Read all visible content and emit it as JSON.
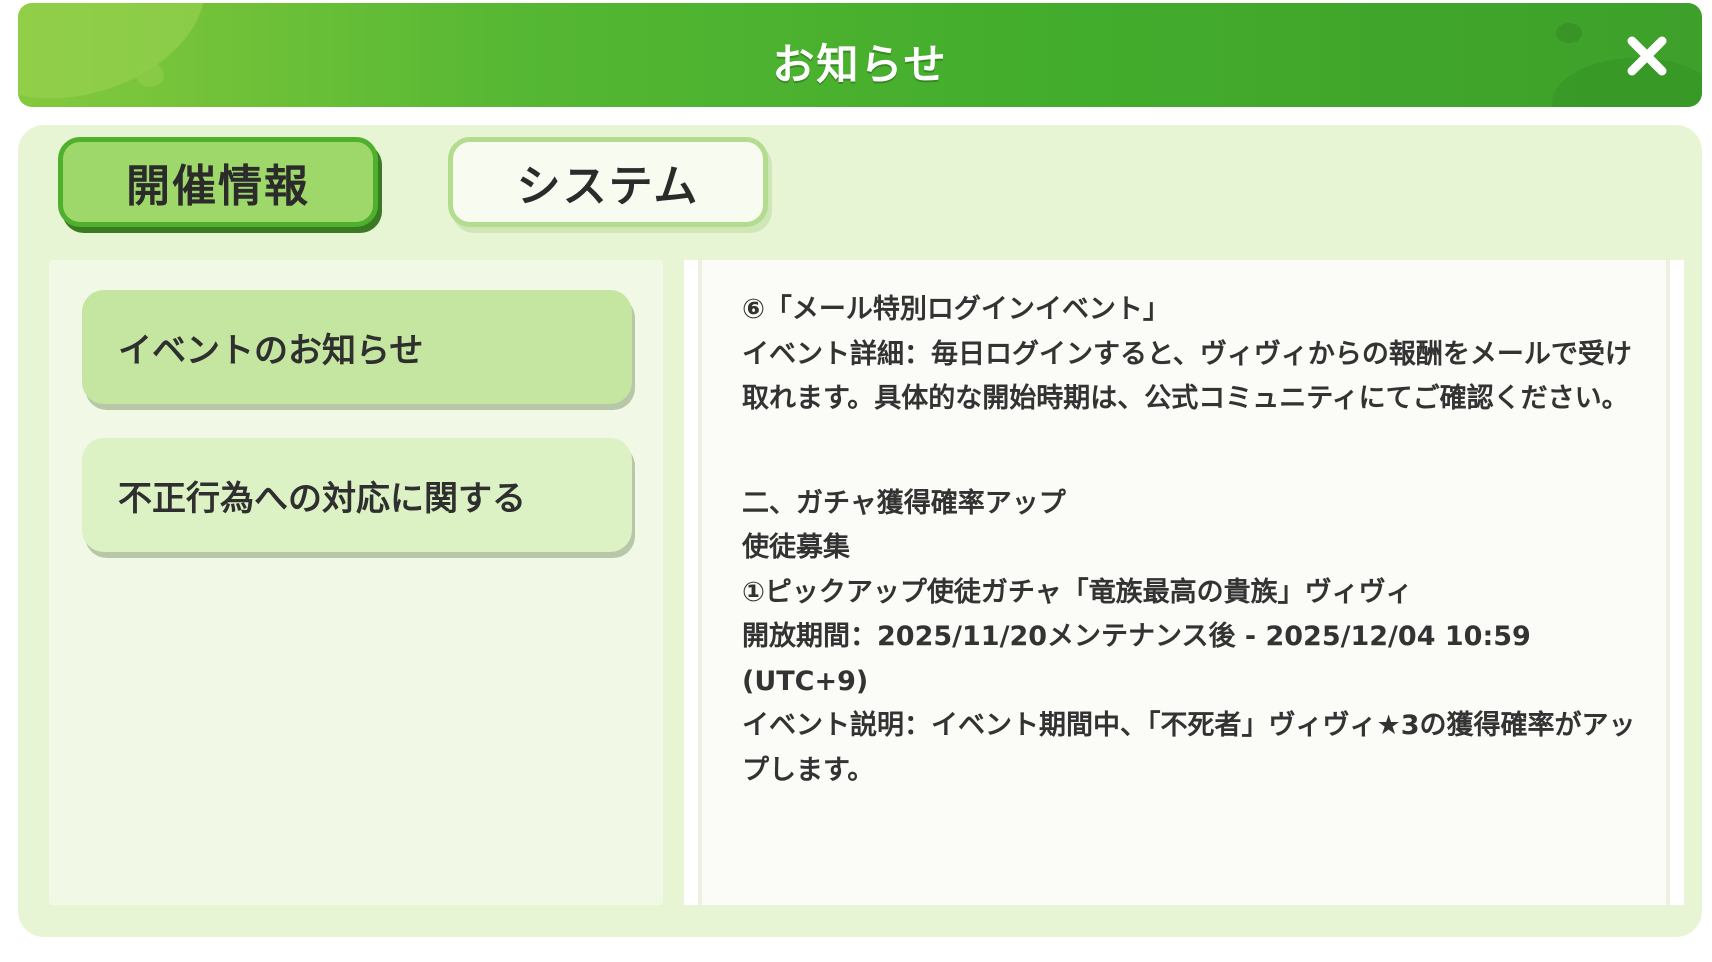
{
  "header": {
    "title": "お知らせ",
    "close_icon": "close-icon"
  },
  "tabs": [
    {
      "label": "開催情報",
      "active": true
    },
    {
      "label": "システム",
      "active": false
    }
  ],
  "list": [
    {
      "label": "イベントのお知らせ",
      "selected": true
    },
    {
      "label": "不正行為への対応に関する",
      "selected": false
    }
  ],
  "content": {
    "block1": [
      "⑥「メール特別ログインイベント」",
      "イベント詳細：毎日ログインすると、ヴィヴィからの報酬をメールで受け取れます。具体的な開始時期は、公式コミュニティにてご確認ください。"
    ],
    "block2": [
      "二、ガチャ獲得確率アップ",
      "使徒募集",
      "①ピックアップ使徒ガチャ「竜族最高の貴族」ヴィヴィ",
      "開放期間：2025/11/20メンテナンス後 - 2025/12/04 10:59 (UTC+9)",
      "イベント説明：イベント期間中、「不死者」ヴィヴィ★3の獲得確率がアップします。"
    ]
  },
  "colors": {
    "header_green": "#43ad2c",
    "panel_bg": "#e8f5d4",
    "tab_active_bg": "#9ed86a",
    "list_selected_bg": "#c4e6a0"
  }
}
